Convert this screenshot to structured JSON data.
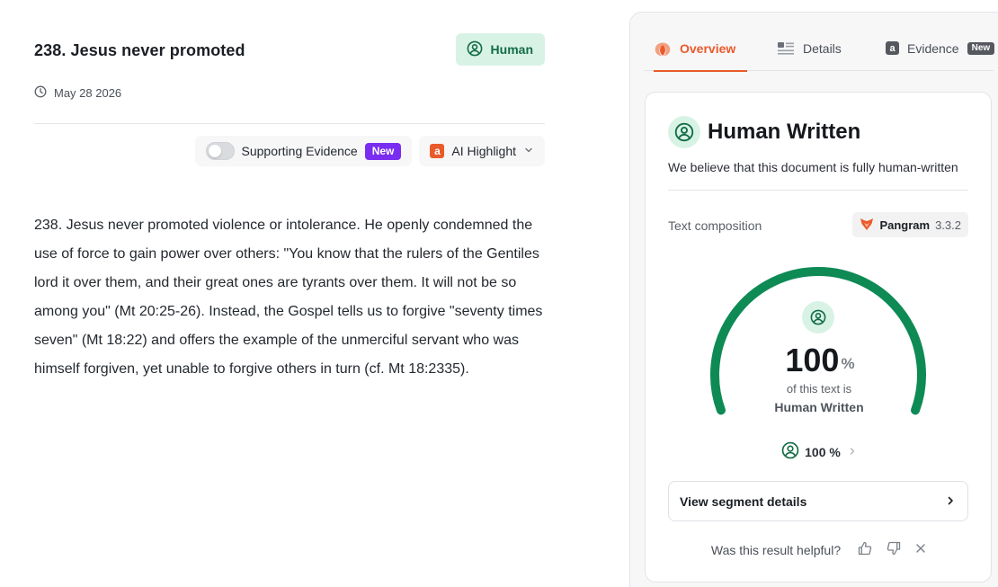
{
  "document": {
    "title": "238. Jesus never promoted",
    "badge_label": "Human",
    "date": "May 28 2026",
    "toolbar": {
      "supporting_evidence_label": "Supporting Evidence",
      "new_badge": "New",
      "ai_highlight_label": "AI Highlight",
      "supporting_evidence_enabled": false
    },
    "paragraphs": [
      "238. Jesus never promoted violence or intolerance. He openly condemned the use of force to gain power over others: \"You know that the rulers of the Gentiles lord it over them, and their great ones are tyrants over them. It will not be so among you\" (Mt 20:25-26). Instead, the Gospel tells us to forgive \"seventy times seven\" (Mt 18:22) and offers the example of the unmerciful servant who was himself forgiven, yet unable to forgive others in turn (cf. Mt 18:2335)."
    ]
  },
  "panel": {
    "tabs": [
      {
        "label": "Overview",
        "active": true,
        "icon": "overview-icon"
      },
      {
        "label": "Details",
        "active": false,
        "icon": "details-icon"
      },
      {
        "label": "Evidence",
        "active": false,
        "icon": "evidence-icon",
        "badge": "New"
      }
    ],
    "result": {
      "title": "Human Written",
      "subtitle": "We believe that this document is fully human-written",
      "composition_label": "Text composition",
      "model_name": "Pangram",
      "model_version": "3.3.2",
      "percent_value": "100",
      "percent_sign": "%",
      "caption_line1": "of this text is",
      "caption_line2": "Human Written",
      "human_fraction": 1.0,
      "breakdown_label": "100 %",
      "segment_button_label": "View segment details",
      "helpful_prompt": "Was this result helpful?"
    },
    "colors": {
      "accent": "#ea5a2b",
      "human_green": "#0e8a55",
      "human_bg": "#d8f3e6",
      "new_purple": "#7a2df0"
    }
  }
}
